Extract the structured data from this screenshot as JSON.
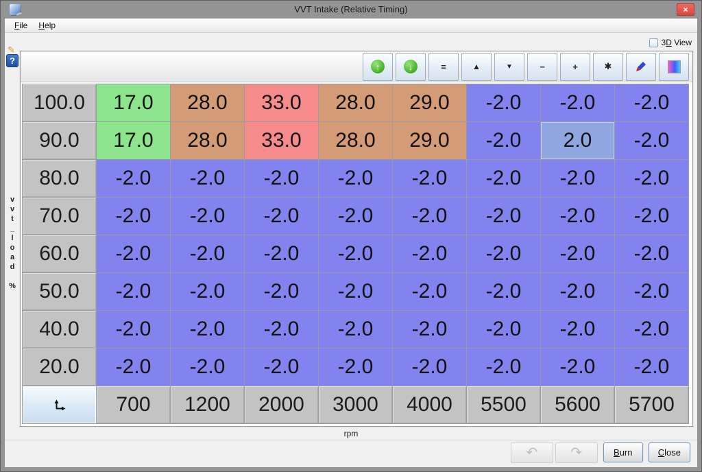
{
  "window": {
    "title": "VVT Intake (Relative Timing)",
    "close_glyph": "×"
  },
  "menu": {
    "items": [
      {
        "label": "File",
        "m": 0
      },
      {
        "label": "Help",
        "m": 0
      }
    ]
  },
  "view_toggle": {
    "label": "3D View",
    "m": 1,
    "checked": false
  },
  "help": {
    "glyph": "?"
  },
  "gutter": {
    "edit_glyph": "✎"
  },
  "toolbar": {
    "buttons": [
      {
        "name": "increase-coarse",
        "glyph": "↑"
      },
      {
        "name": "decrease-coarse",
        "glyph": "↓"
      },
      {
        "name": "set-equal",
        "glyph": "="
      },
      {
        "name": "increment-up",
        "glyph": "▲"
      },
      {
        "name": "increment-down",
        "glyph": "▼"
      },
      {
        "name": "subtract",
        "glyph": "−"
      },
      {
        "name": "add",
        "glyph": "+"
      },
      {
        "name": "multiply",
        "glyph": "✱"
      },
      {
        "name": "edit-cell",
        "glyph": ""
      },
      {
        "name": "color-scale",
        "glyph": ""
      }
    ]
  },
  "axis": {
    "y_label": "vvt_load %",
    "x_label": "rpm"
  },
  "colors": {
    "green": "#8ce48c",
    "tan": "#d49b77",
    "red": "#f68b8b",
    "blue": "#8383ef",
    "lightblue": "#8fa7e0"
  },
  "table": {
    "col_headers": [
      "700",
      "1200",
      "2000",
      "3000",
      "4000",
      "5500",
      "5600",
      "5700"
    ],
    "rows": [
      {
        "load": "100.0",
        "values": [
          {
            "v": "17.0",
            "bg": "green"
          },
          {
            "v": "28.0",
            "bg": "tan"
          },
          {
            "v": "33.0",
            "bg": "red"
          },
          {
            "v": "28.0",
            "bg": "tan"
          },
          {
            "v": "29.0",
            "bg": "tan"
          },
          {
            "v": "-2.0",
            "bg": "blue"
          },
          {
            "v": "-2.0",
            "bg": "blue"
          },
          {
            "v": "-2.0",
            "bg": "blue"
          }
        ]
      },
      {
        "load": "90.0",
        "values": [
          {
            "v": "17.0",
            "bg": "green"
          },
          {
            "v": "28.0",
            "bg": "tan"
          },
          {
            "v": "33.0",
            "bg": "red"
          },
          {
            "v": "28.0",
            "bg": "tan"
          },
          {
            "v": "29.0",
            "bg": "tan"
          },
          {
            "v": "-2.0",
            "bg": "blue"
          },
          {
            "v": "2.0",
            "bg": "lightblue",
            "selected": true
          },
          {
            "v": "-2.0",
            "bg": "blue"
          }
        ]
      },
      {
        "load": "80.0",
        "values": [
          {
            "v": "-2.0",
            "bg": "blue"
          },
          {
            "v": "-2.0",
            "bg": "blue"
          },
          {
            "v": "-2.0",
            "bg": "blue"
          },
          {
            "v": "-2.0",
            "bg": "blue"
          },
          {
            "v": "-2.0",
            "bg": "blue"
          },
          {
            "v": "-2.0",
            "bg": "blue"
          },
          {
            "v": "-2.0",
            "bg": "blue"
          },
          {
            "v": "-2.0",
            "bg": "blue"
          }
        ]
      },
      {
        "load": "70.0",
        "values": [
          {
            "v": "-2.0",
            "bg": "blue"
          },
          {
            "v": "-2.0",
            "bg": "blue"
          },
          {
            "v": "-2.0",
            "bg": "blue"
          },
          {
            "v": "-2.0",
            "bg": "blue"
          },
          {
            "v": "-2.0",
            "bg": "blue"
          },
          {
            "v": "-2.0",
            "bg": "blue"
          },
          {
            "v": "-2.0",
            "bg": "blue"
          },
          {
            "v": "-2.0",
            "bg": "blue"
          }
        ]
      },
      {
        "load": "60.0",
        "values": [
          {
            "v": "-2.0",
            "bg": "blue"
          },
          {
            "v": "-2.0",
            "bg": "blue"
          },
          {
            "v": "-2.0",
            "bg": "blue"
          },
          {
            "v": "-2.0",
            "bg": "blue"
          },
          {
            "v": "-2.0",
            "bg": "blue"
          },
          {
            "v": "-2.0",
            "bg": "blue"
          },
          {
            "v": "-2.0",
            "bg": "blue"
          },
          {
            "v": "-2.0",
            "bg": "blue"
          }
        ]
      },
      {
        "load": "50.0",
        "values": [
          {
            "v": "-2.0",
            "bg": "blue"
          },
          {
            "v": "-2.0",
            "bg": "blue"
          },
          {
            "v": "-2.0",
            "bg": "blue"
          },
          {
            "v": "-2.0",
            "bg": "blue"
          },
          {
            "v": "-2.0",
            "bg": "blue"
          },
          {
            "v": "-2.0",
            "bg": "blue"
          },
          {
            "v": "-2.0",
            "bg": "blue"
          },
          {
            "v": "-2.0",
            "bg": "blue"
          }
        ]
      },
      {
        "load": "40.0",
        "values": [
          {
            "v": "-2.0",
            "bg": "blue"
          },
          {
            "v": "-2.0",
            "bg": "blue"
          },
          {
            "v": "-2.0",
            "bg": "blue"
          },
          {
            "v": "-2.0",
            "bg": "blue"
          },
          {
            "v": "-2.0",
            "bg": "blue"
          },
          {
            "v": "-2.0",
            "bg": "blue"
          },
          {
            "v": "-2.0",
            "bg": "blue"
          },
          {
            "v": "-2.0",
            "bg": "blue"
          }
        ]
      },
      {
        "load": "20.0",
        "values": [
          {
            "v": "-2.0",
            "bg": "blue"
          },
          {
            "v": "-2.0",
            "bg": "blue"
          },
          {
            "v": "-2.0",
            "bg": "blue"
          },
          {
            "v": "-2.0",
            "bg": "blue"
          },
          {
            "v": "-2.0",
            "bg": "blue"
          },
          {
            "v": "-2.0",
            "bg": "blue"
          },
          {
            "v": "-2.0",
            "bg": "blue"
          },
          {
            "v": "-2.0",
            "bg": "blue"
          }
        ]
      }
    ]
  },
  "footer": {
    "undo_glyph": "↶",
    "redo_glyph": "↷",
    "burn": {
      "label": "Burn",
      "m": 0
    },
    "close": {
      "label": "Close",
      "m": 0
    }
  }
}
